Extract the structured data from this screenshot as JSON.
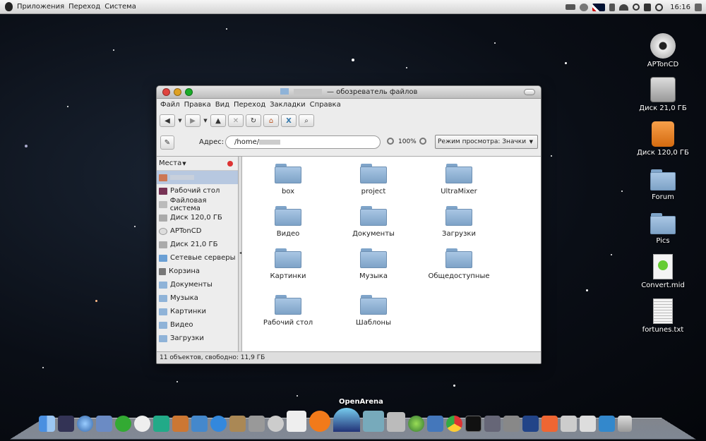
{
  "topbar": {
    "apple_icon": "apple-icon",
    "menus": [
      "Приложения",
      "Переход",
      "Система"
    ],
    "clock": "16:16"
  },
  "desktop_icons": [
    {
      "label": "APTonCD",
      "icon": "cd-icon"
    },
    {
      "label": "Диск 21,0 ГБ",
      "icon": "harddisk-icon"
    },
    {
      "label": "Диск 120,0 ГБ",
      "icon": "usb-drive-icon"
    },
    {
      "label": "Forum",
      "icon": "folder-icon"
    },
    {
      "label": "Pics",
      "icon": "folder-icon"
    },
    {
      "label": "Convert.mid",
      "icon": "audio-file-icon"
    },
    {
      "label": "fortunes.txt",
      "icon": "text-file-icon"
    }
  ],
  "window": {
    "title": "— обозреватель файлов",
    "menu": [
      "Файл",
      "Правка",
      "Вид",
      "Переход",
      "Закладки",
      "Справка"
    ],
    "address_label": "Адрес:",
    "address_value": "/home/",
    "zoom": "100%",
    "view_mode": "Режим просмотра: Значки",
    "places_header": "Места",
    "places": [
      {
        "label": "",
        "icon": "home-icon"
      },
      {
        "label": "Рабочий стол",
        "icon": "desktop-icon"
      },
      {
        "label": "Файловая система",
        "icon": "filesystem-icon"
      },
      {
        "label": "Диск 120,0 ГБ",
        "icon": "drive-icon"
      },
      {
        "label": "APTonCD",
        "icon": "cd-icon"
      },
      {
        "label": "Диск 21,0 ГБ",
        "icon": "drive-icon"
      },
      {
        "label": "Сетевые серверы",
        "icon": "network-icon"
      },
      {
        "label": "Корзина",
        "icon": "trash-icon"
      },
      {
        "label": "Документы",
        "icon": "folder-icon"
      },
      {
        "label": "Музыка",
        "icon": "folder-icon"
      },
      {
        "label": "Картинки",
        "icon": "folder-icon"
      },
      {
        "label": "Видео",
        "icon": "folder-icon"
      },
      {
        "label": "Загрузки",
        "icon": "folder-icon"
      }
    ],
    "files": [
      "box",
      "project",
      "UltraMixer",
      "Видео",
      "Документы",
      "Загрузки",
      "Картинки",
      "Музыка",
      "Общедоступные",
      "Рабочий стол",
      "Шаблоны"
    ],
    "status": "11 объектов, свободно: 11,9 ГБ"
  },
  "dock": {
    "hover_label": "OpenArena"
  },
  "colors": {
    "folder": "#8fb3d8",
    "sidebar_selected": "#b7c8e0",
    "close": "#e0443e",
    "minimize": "#dea123",
    "zoom": "#1aab29"
  }
}
